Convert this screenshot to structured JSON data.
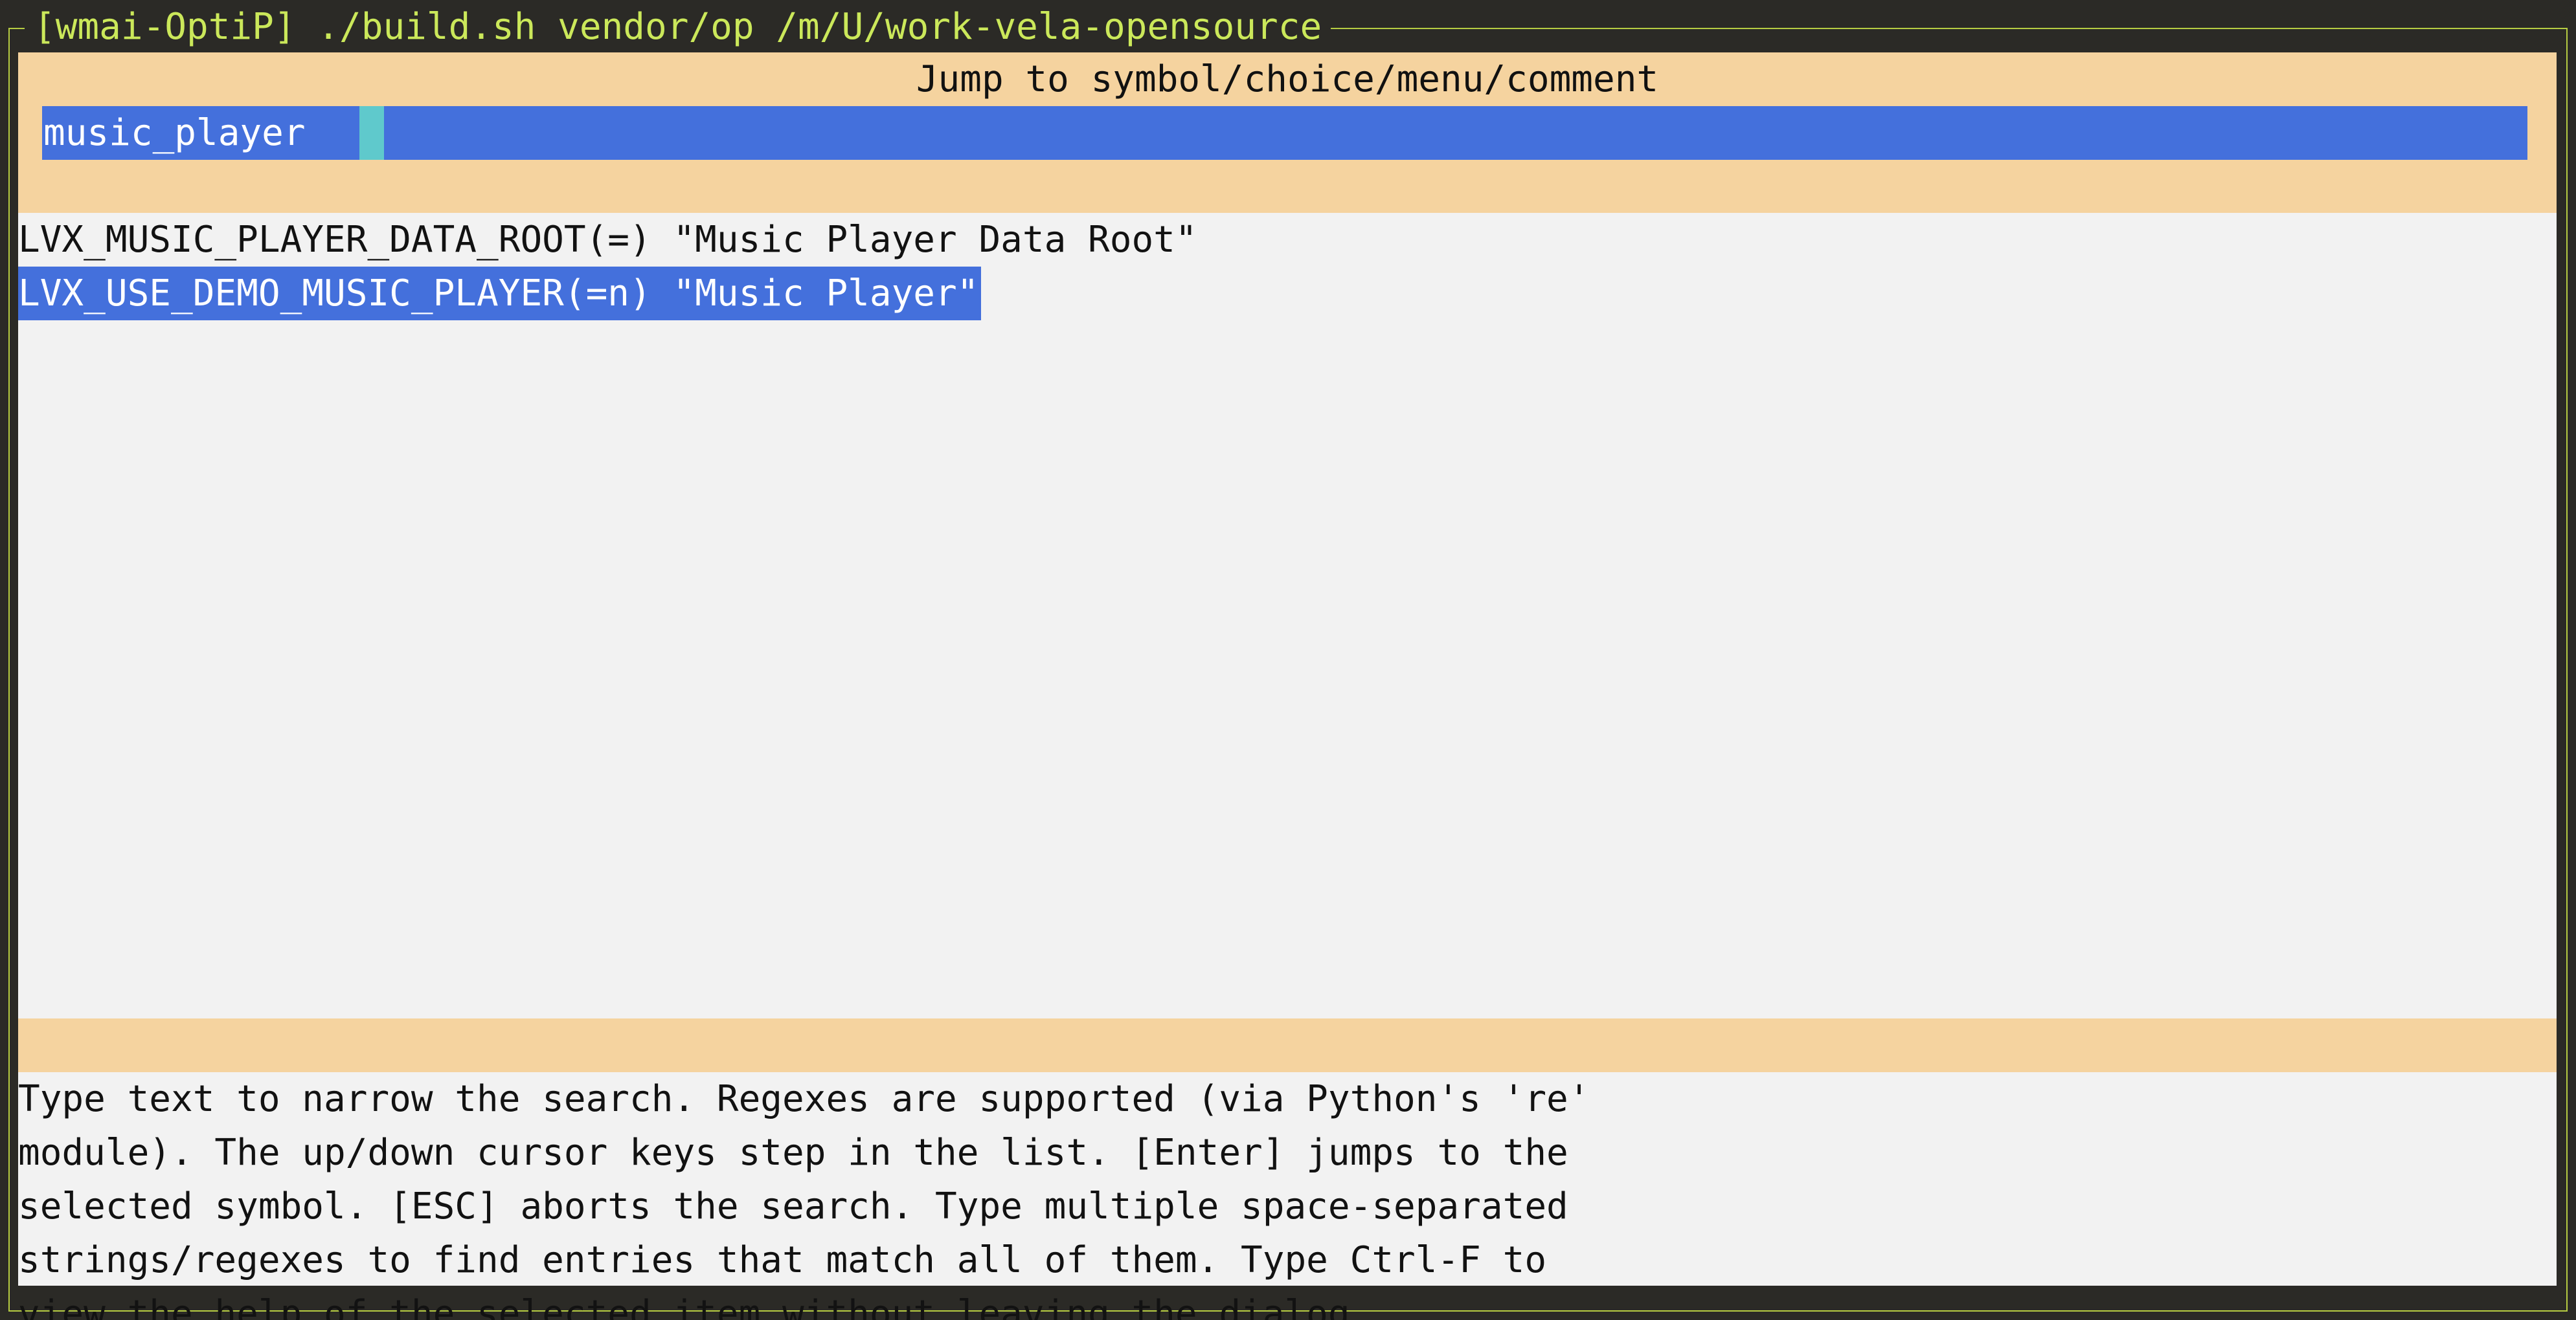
{
  "window": {
    "title": "[wmai-OptiP] ./build.sh vendor/op /m/U/work-vela-opensource"
  },
  "dialog": {
    "title": "Jump to symbol/choice/menu/comment"
  },
  "search": {
    "value": "music_player"
  },
  "results": [
    {
      "text": "LVX_MUSIC_PLAYER_DATA_ROOT(=) \"Music Player Data Root\"",
      "selected": false
    },
    {
      "text": "LVX_USE_DEMO_MUSIC_PLAYER(=n) \"Music Player\"",
      "selected": true
    }
  ],
  "help": {
    "lines": [
      "Type text to narrow the search. Regexes are supported (via Python's 're'",
      "module). The up/down cursor keys step in the list. [Enter] jumps to the",
      "selected symbol. [ESC] aborts the search. Type multiple space-separated",
      "strings/regexes to find entries that match all of them. Type Ctrl-F to",
      "view the help of the selected item without leaving the dialog."
    ]
  },
  "colors": {
    "background": "#2b2a26",
    "frame_border": "#b6cc42",
    "window_title": "#cbe85a",
    "panel": "#f5d39f",
    "content": "#f2f2f2",
    "highlight": "#4470dc",
    "cursor": "#5fc9cc"
  }
}
